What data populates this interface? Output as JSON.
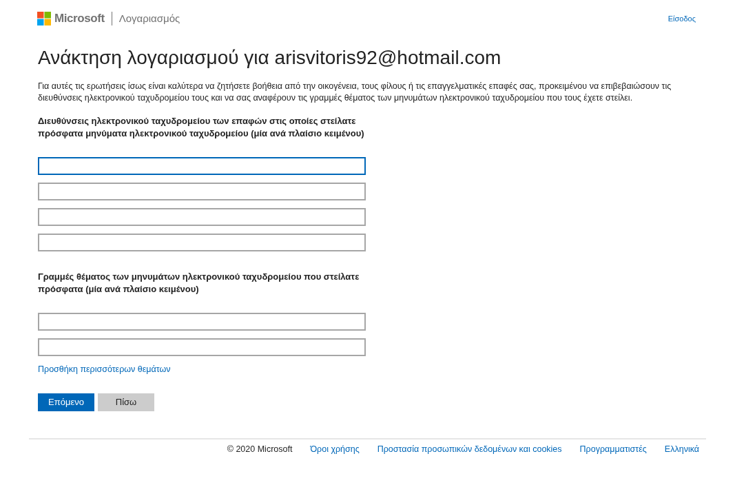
{
  "header": {
    "brand": "Microsoft",
    "section": "Λογαριασμός",
    "sign_in": "Είσοδος"
  },
  "title": "Ανάκτηση λογαριασμού για arisvitoris92@hotmail.com",
  "intro": "Για αυτές τις ερωτήσεις ίσως είναι καλύτερα να ζητήσετε βοήθεια από την οικογένεια, τους φίλους ή τις επαγγελματικές επαφές σας, προκειμένου να επιβεβαιώσουν τις διευθύνσεις ηλεκτρονικού ταχυδρομείου τους και να σας αναφέρουν τις γραμμές θέματος των μηνυμάτων ηλεκτρονικού ταχυδρομείου που τους έχετε στείλει.",
  "email_section": {
    "label": "Διευθύνσεις ηλεκτρονικού ταχυδρομείου των επαφών στις οποίες στείλατε πρόσφατα μηνύματα ηλεκτρονικού ταχυδρομείου (μία ανά πλαίσιο κειμένου)",
    "fields": [
      {
        "focused": true
      },
      {
        "focused": false
      },
      {
        "focused": false
      },
      {
        "focused": false
      }
    ]
  },
  "subject_section": {
    "label": "Γραμμές θέματος των μηνυμάτων ηλεκτρονικού ταχυδρομείου που στείλατε πρόσφατα (μία ανά πλαίσιο κειμένου)",
    "fields": [
      {
        "focused": false
      },
      {
        "focused": false
      }
    ]
  },
  "add_more_link": "Προσθήκη περισσότερων θεμάτων",
  "buttons": [
    {
      "label": "Επόμενο",
      "kind": "primary"
    },
    {
      "label": "Πίσω",
      "kind": "secondary"
    }
  ],
  "footer": {
    "copyright": "© 2020 Microsoft",
    "links": [
      "Όροι χρήσης",
      "Προστασία προσωπικών δεδομένων και cookies",
      "Προγραμματιστές",
      "Ελληνικά"
    ]
  }
}
